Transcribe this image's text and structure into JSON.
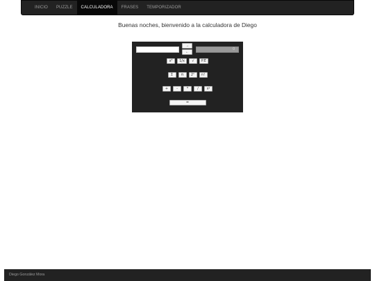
{
  "nav": {
    "items": [
      {
        "label": "INICIO",
        "active": false
      },
      {
        "label": "PUZZLE",
        "active": false
      },
      {
        "label": "CALCULADORA",
        "active": true
      },
      {
        "label": "FRASES",
        "active": false
      },
      {
        "label": "TEMPORIZADOR",
        "active": false
      }
    ]
  },
  "welcome": "Buenas noches, bienvenido a la calculadora de Diego",
  "calculator": {
    "input_value": "",
    "arrow_right": "→",
    "arrow_left": "←",
    "result_value": "0",
    "row1": [
      "x²",
      "1/x",
      "√",
      "P.E"
    ],
    "row2": [
      "Σ",
      "π",
      "2ⁿ",
      "n!"
    ],
    "row3": [
      "+",
      "-",
      "*",
      "/",
      "xʸ"
    ],
    "equals": "="
  },
  "footer": {
    "text": "Diego González Mora"
  },
  "colors": {
    "navbar": "#222222",
    "active_nav": "#080808",
    "calc_bg": "#222222",
    "footer": "#222222"
  }
}
